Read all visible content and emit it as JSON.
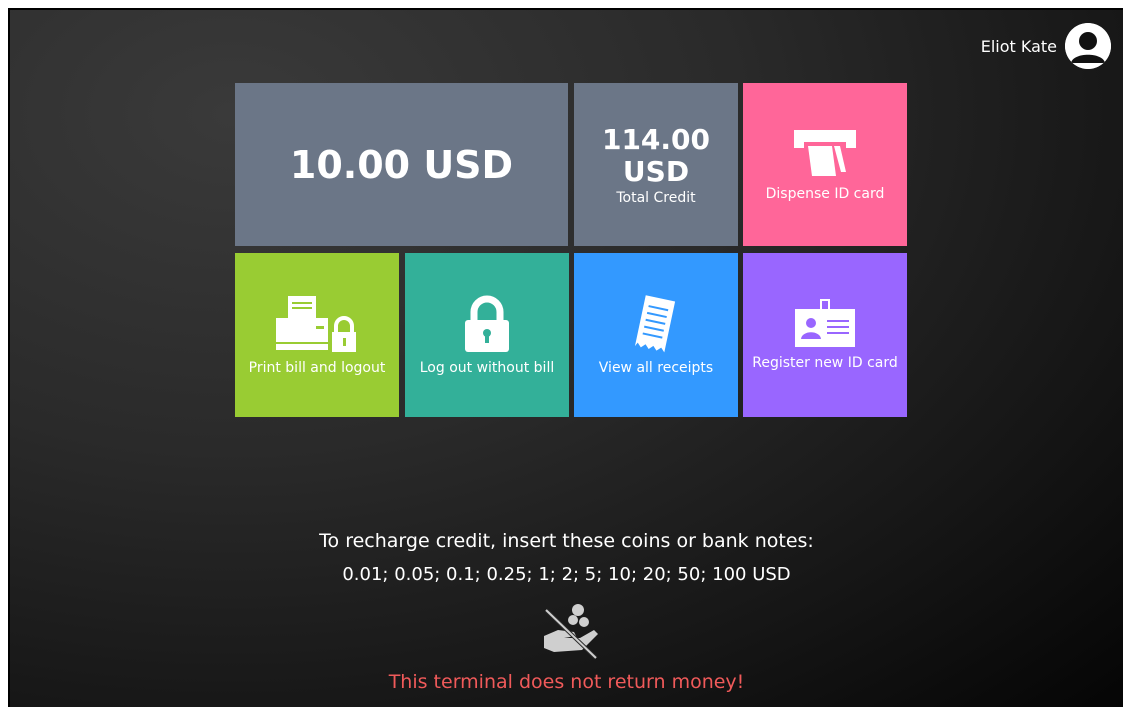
{
  "user": {
    "name": "Eliot Kate"
  },
  "tiles": {
    "current_amount": "10.00 USD",
    "total_credit": {
      "amount": "114.00 USD",
      "label": "Total Credit"
    },
    "dispense": {
      "label": "Dispense ID card",
      "icon": "card-dispenser-icon",
      "color": "#ff6699"
    },
    "print": {
      "label": "Print bill and logout",
      "icon": "printer-lock-icon",
      "color": "#99cc33"
    },
    "logout": {
      "label": "Log out without bill",
      "icon": "padlock-icon",
      "color": "#33b099"
    },
    "receipts": {
      "label": "View all receipts",
      "icon": "receipts-icon",
      "color": "#3399ff"
    },
    "register": {
      "label": "Register new ID card",
      "icon": "id-card-icon",
      "color": "#9966ff"
    },
    "gray": "#6b7687"
  },
  "recharge": {
    "line1": "To recharge credit, insert these coins or bank notes:",
    "line2": "0.01; 0.05; 0.1; 0.25; 1; 2; 5; 10; 20; 50; 100 USD",
    "icon": "no-change-return-icon",
    "warning": "This terminal does not return money!",
    "warning_color": "#f05a5a"
  }
}
